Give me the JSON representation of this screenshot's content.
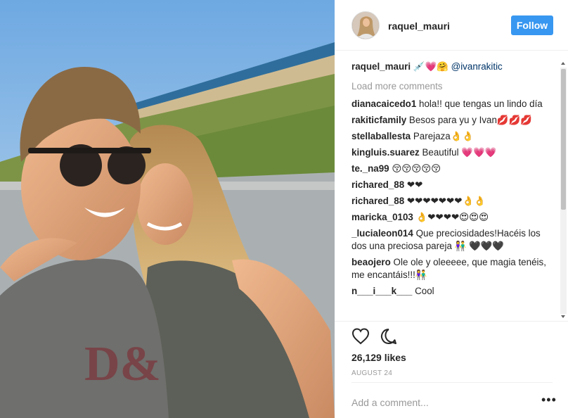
{
  "post": {
    "username": "raquel_mauri",
    "follow_label": "Follow",
    "caption": {
      "user": "raquel_mauri",
      "text": "💉💗🤗",
      "mention": "@ivanrakitic"
    },
    "load_more": "Load more comments",
    "comments": [
      {
        "user": "dianacaicedo1",
        "text": "hola!! que tengas un lindo día"
      },
      {
        "user": "rakiticfamily",
        "text": "Besos para yu y Ivan💋💋💋"
      },
      {
        "user": "stellaballesta",
        "text": "Parejaza👌👌"
      },
      {
        "user": "kingluis.suarez",
        "text": "Beautiful 💗💗💗"
      },
      {
        "user": "te._na99",
        "text": "😚😚😚😚😚"
      },
      {
        "user": "richared_88",
        "text": "❤❤"
      },
      {
        "user": "richared_88",
        "text": "❤❤❤❤❤❤❤👌👌"
      },
      {
        "user": "maricka_0103",
        "text": "👌❤❤❤❤😍😍😍"
      },
      {
        "user": "_lucialeon014",
        "text": "Que preciosidades!Hacéis los dos una preciosa pareja 👫 🖤🖤🖤"
      },
      {
        "user": "beaojero",
        "text": "Ole ole y oleeeee, que magia tenéis, me encantáis!!!👫"
      },
      {
        "user": "n___i___k___",
        "text": "Cool"
      }
    ],
    "likes": "26,129 likes",
    "date": "AUGUST 24",
    "add_comment_placeholder": "Add a comment...",
    "more_label": "•••",
    "icons": {
      "like": "heart-icon",
      "comment": "speech-bubble-icon",
      "options": "ellipsis-icon"
    },
    "colors": {
      "follow_bg": "#3897f0",
      "text": "#262626",
      "muted": "#999999",
      "mention": "#003569"
    }
  }
}
